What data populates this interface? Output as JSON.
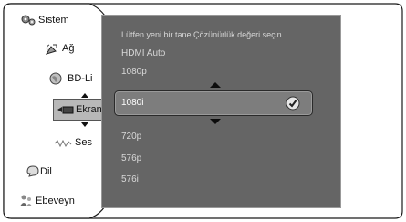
{
  "menu": {
    "items": [
      {
        "label": "Sistem",
        "icon": "gears-icon"
      },
      {
        "label": "Ağ",
        "icon": "satellite-dish-icon"
      },
      {
        "label": "BD-Li",
        "icon": "globe-icon"
      },
      {
        "label": "Ekran",
        "icon": "display-icon"
      },
      {
        "label": "Ses",
        "icon": "speaker-icon"
      },
      {
        "label": "Dil",
        "icon": "language-icon"
      },
      {
        "label": "Ebeveyn",
        "icon": "family-icon"
      }
    ]
  },
  "dialog": {
    "prompt": "Lütfen yeni bir tane Çözünürlük değeri seçin",
    "options": [
      "HDMI Auto",
      "1080p",
      "1080i",
      "720p",
      "576p",
      "576i"
    ],
    "selected": "1080i"
  },
  "colors": {
    "panel": "#656565",
    "selection": "#7d7d7d",
    "option_text": "#d8d8d8"
  }
}
